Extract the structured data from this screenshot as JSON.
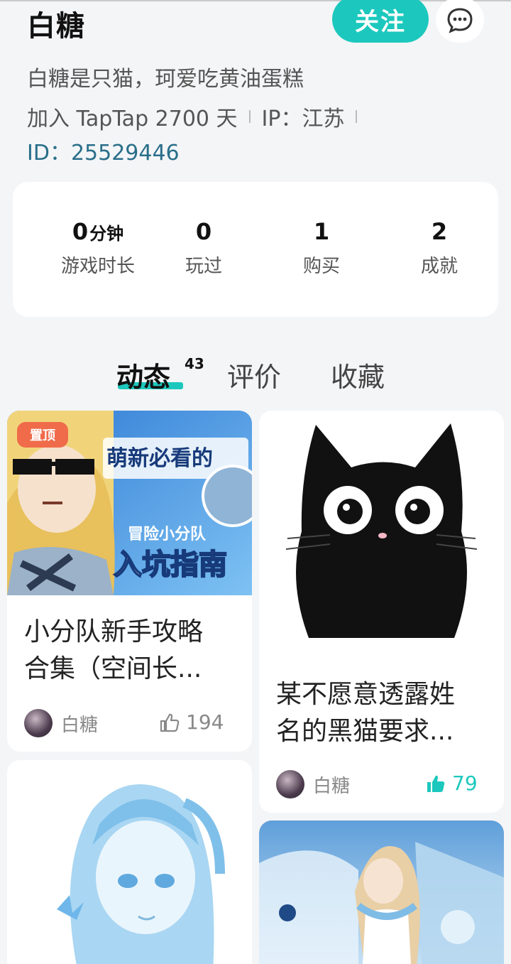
{
  "profile": {
    "name": "白糖",
    "follow_label": "关注",
    "bio": "白糖是只猫，珂爱吃黄油蛋糕",
    "join_text": "加入 TapTap 2700 天",
    "ip_text": "IP：江苏",
    "id_text": "ID：25529446"
  },
  "stats": [
    {
      "value": "0",
      "unit": "分钟",
      "label": "游戏时长"
    },
    {
      "value": "0",
      "unit": "",
      "label": "玩过"
    },
    {
      "value": "1",
      "unit": "",
      "label": "购买"
    },
    {
      "value": "2",
      "unit": "",
      "label": "成就"
    }
  ],
  "tabs": {
    "feed": "动态",
    "feed_count": "43",
    "reviews": "评价",
    "favorites": "收藏"
  },
  "posts": [
    {
      "badge": "置顶",
      "title_line1": "小分队新手攻略",
      "title_line2": "合集（空间长...",
      "author": "白糖",
      "likes": "194",
      "image_text_top": "萌新必看的",
      "image_text_mid": "冒险小分队",
      "image_text_bottom": "入坑指南"
    },
    {
      "title_line1": "某不愿意透露姓",
      "title_line2": "名的黑猫要求...",
      "author": "白糖",
      "likes": "79"
    }
  ],
  "colors": {
    "accent": "#1cc8bd",
    "pin": "#f06b4a",
    "id_text": "#2a6f8a"
  }
}
